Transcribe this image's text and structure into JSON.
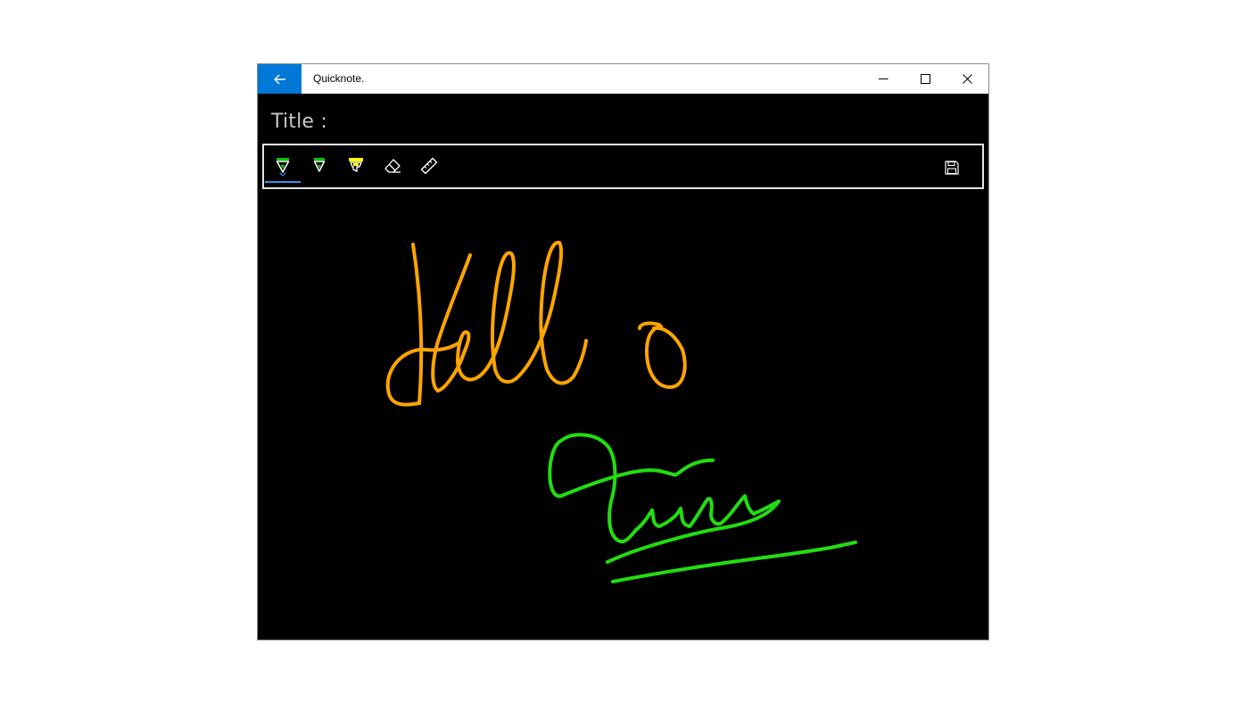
{
  "app": {
    "title": "Quicknote."
  },
  "titlebar": {
    "back_icon": "back-arrow-icon",
    "accent_color": "#0078d7",
    "controls": [
      "minimize-icon",
      "maximize-icon",
      "close-icon"
    ]
  },
  "note": {
    "title_label": "Title :"
  },
  "toolbar": {
    "tools": [
      {
        "name": "ballpoint-pen",
        "icon": "pen-icon",
        "color": "#00c800",
        "selected": true
      },
      {
        "name": "pencil",
        "icon": "pencil-icon",
        "color": "#00c800",
        "selected": false
      },
      {
        "name": "highlighter",
        "icon": "highlighter-icon",
        "color": "#ffff00",
        "selected": false
      },
      {
        "name": "eraser",
        "icon": "eraser-icon",
        "selected": false
      },
      {
        "name": "ruler",
        "icon": "ruler-icon",
        "selected": false
      }
    ],
    "save_icon": "save-icon",
    "selected_indicator_color": "#3a8fe8"
  },
  "ink": {
    "strokes": [
      {
        "description": "handwritten word in orange ink",
        "color": "#ffa500"
      },
      {
        "description": "handwritten signature in green ink",
        "color": "#22dd11"
      }
    ]
  }
}
